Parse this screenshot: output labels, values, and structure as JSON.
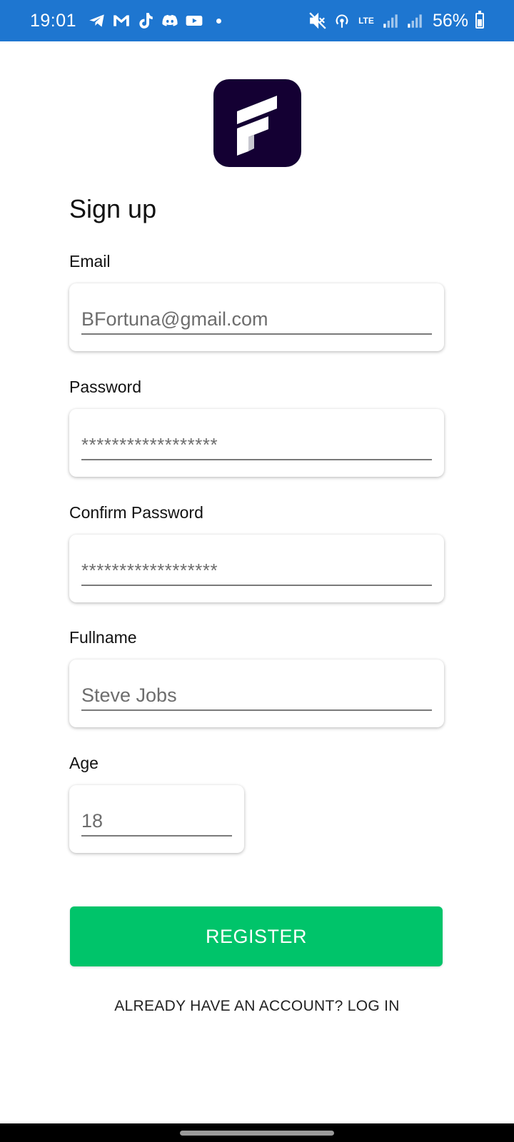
{
  "status_bar": {
    "time": "19:01",
    "left_icons": [
      "telegram-icon",
      "gmail-icon",
      "tiktok-icon",
      "discord-icon",
      "youtube-icon"
    ],
    "network_label": "LTE",
    "battery_percent": "56%",
    "battery_level": 0.56,
    "bar_color": "#1e76d0"
  },
  "logo": {
    "icon": "app-logo-icon",
    "background": "#140033"
  },
  "form": {
    "title": "Sign up",
    "email": {
      "label": "Email",
      "value": "BFortuna@gmail.com"
    },
    "password": {
      "label": "Password",
      "value": "******************"
    },
    "confirm_password": {
      "label": "Confirm Password",
      "value": "******************"
    },
    "fullname": {
      "label": "Fullname",
      "value": "Steve Jobs"
    },
    "age": {
      "label": "Age",
      "value": "18"
    }
  },
  "actions": {
    "register_label": "REGISTER",
    "register_color": "#00c46a",
    "login_prompt": "ALREADY HAVE AN ACCOUNT? LOG IN"
  }
}
